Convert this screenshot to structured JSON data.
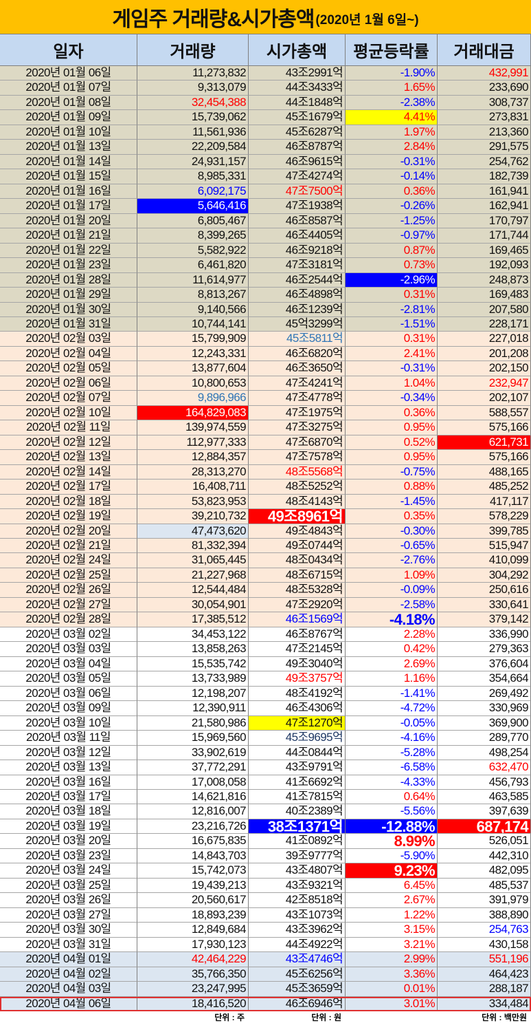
{
  "title": {
    "main": "게임주 거래량&시가총액",
    "sub": "(2020년 1월 6일~)"
  },
  "headers": [
    "일자",
    "거래량",
    "시가총액",
    "평균등락률",
    "거래대금"
  ],
  "footer": {
    "volume_unit": "단위 : 주",
    "cap_unit": "단위 : 원",
    "amount_unit": "단위 : 백만원"
  },
  "colors": {
    "title_bg": "#ffc000",
    "header_bg": "#c5d9f1",
    "jan_bg": "#ddd9c4",
    "feb_bg": "#fde9d9",
    "mar_bg": "#ffffff",
    "apr_bg": "#dce6f1",
    "up": "#ff0000",
    "down": "#0000ff"
  },
  "rows": [
    [
      "2020년 01월 06일",
      "11,273,832",
      "43조2991억",
      "-1.90%",
      "432,991",
      "jan",
      {
        "a": "red"
      }
    ],
    [
      "2020년 01월 07일",
      "9,313,079",
      "44조3433억",
      "1.65%",
      "233,690",
      "jan",
      {}
    ],
    [
      "2020년 01월 08일",
      "32,454,388",
      "44조1848억",
      "-2.38%",
      "308,737",
      "jan",
      {
        "v": "red"
      }
    ],
    [
      "2020년 01월 09일",
      "15,739,062",
      "45조1679억",
      "4.41%",
      "273,831",
      "jan",
      {
        "r": "yfill"
      }
    ],
    [
      "2020년 01월 10일",
      "11,561,936",
      "45조6287억",
      "1.97%",
      "213,360",
      "jan",
      {}
    ],
    [
      "2020년 01월 13일",
      "22,209,584",
      "46조8787억",
      "2.84%",
      "291,575",
      "jan",
      {}
    ],
    [
      "2020년 01월 14일",
      "24,931,157",
      "46조9615억",
      "-0.31%",
      "254,762",
      "jan",
      {}
    ],
    [
      "2020년 01월 15일",
      "8,985,331",
      "47조4274억",
      "-0.14%",
      "182,739",
      "jan",
      {}
    ],
    [
      "2020년 01월 16일",
      "6,092,175",
      "47조7500억",
      "0.36%",
      "161,941",
      "jan",
      {
        "v": "blue",
        "c": "red"
      }
    ],
    [
      "2020년 01월 17일",
      "5,646,416",
      "47조1938억",
      "-0.26%",
      "162,941",
      "jan",
      {
        "v": "bfill"
      }
    ],
    [
      "2020년 01월 20일",
      "6,805,467",
      "46조8587억",
      "-1.25%",
      "170,797",
      "jan",
      {}
    ],
    [
      "2020년 01월 21일",
      "8,399,265",
      "46조4405억",
      "-0.97%",
      "171,744",
      "jan",
      {}
    ],
    [
      "2020년 01월 22일",
      "5,582,922",
      "46조9218억",
      "0.87%",
      "169,465",
      "jan",
      {}
    ],
    [
      "2020년 01월 23일",
      "6,461,820",
      "47조3181억",
      "0.73%",
      "192,093",
      "jan",
      {}
    ],
    [
      "2020년 01월 28일",
      "11,614,977",
      "46조2544억",
      "-2.96%",
      "248,873",
      "jan",
      {
        "r": "bfill"
      }
    ],
    [
      "2020년 01월 29일",
      "8,813,267",
      "46조4898억",
      "0.31%",
      "169,483",
      "jan",
      {}
    ],
    [
      "2020년 01월 30일",
      "9,140,566",
      "46조1239억",
      "-2.81%",
      "207,580",
      "jan",
      {}
    ],
    [
      "2020년 01월 31일",
      "10,744,141",
      "45억3299억",
      "-1.51%",
      "228,171",
      "jan",
      {}
    ],
    [
      "2020년 02월 03일",
      "15,799,909",
      "45조5811억",
      "0.31%",
      "227,018",
      "feb",
      {
        "c": "lblue"
      }
    ],
    [
      "2020년 02월 04일",
      "12,243,331",
      "46조6820억",
      "2.41%",
      "201,208",
      "feb",
      {}
    ],
    [
      "2020년 02월 05일",
      "13,877,604",
      "46조3650억",
      "-0.31%",
      "202,150",
      "feb",
      {}
    ],
    [
      "2020년 02월 06일",
      "10,800,653",
      "47조4241억",
      "1.04%",
      "232,947",
      "feb",
      {
        "a": "red"
      }
    ],
    [
      "2020년 02월 07일",
      "9,896,966",
      "47조4778억",
      "-0.34%",
      "202,107",
      "feb",
      {
        "v": "lblue"
      }
    ],
    [
      "2020년 02월 10일",
      "164,829,083",
      "47조1975억",
      "0.36%",
      "588,557",
      "feb",
      {
        "v": "rfill"
      }
    ],
    [
      "2020년 02월 11일",
      "139,974,559",
      "47조3275억",
      "0.95%",
      "575,166",
      "feb",
      {}
    ],
    [
      "2020년 02월 12일",
      "112,977,333",
      "47조6870억",
      "0.52%",
      "621,731",
      "feb",
      {
        "a": "rfill"
      }
    ],
    [
      "2020년 02월 13일",
      "12,884,357",
      "47조7578억",
      "0.95%",
      "575,166",
      "feb",
      {}
    ],
    [
      "2020년 02월 14일",
      "28,313,270",
      "48조5568억",
      "-0.75%",
      "488,165",
      "feb",
      {
        "c": "red"
      }
    ],
    [
      "2020년 02월 17일",
      "16,408,711",
      "48조5252억",
      "0.88%",
      "485,252",
      "feb",
      {}
    ],
    [
      "2020년 02월 18일",
      "53,823,953",
      "48조4143억",
      "-1.45%",
      "417,117",
      "feb",
      {}
    ],
    [
      "2020년 02월 19일",
      "39,210,732",
      "49조8961억",
      "0.35%",
      "578,229",
      "feb",
      {
        "c": "rfill big"
      }
    ],
    [
      "2020년 02월 20일",
      "47,473,620",
      "49조4843억",
      "-0.30%",
      "399,785",
      "feb",
      {
        "v": "lbfill"
      }
    ],
    [
      "2020년 02월 21일",
      "81,332,394",
      "49조0744억",
      "-0.65%",
      "515,947",
      "feb",
      {}
    ],
    [
      "2020년 02월 24일",
      "31,065,445",
      "48조0434억",
      "-2.76%",
      "410,099",
      "feb",
      {}
    ],
    [
      "2020년 02월 25일",
      "21,227,968",
      "48조6715억",
      "1.09%",
      "304,292",
      "feb",
      {}
    ],
    [
      "2020년 02월 26일",
      "12,544,484",
      "48조5328억",
      "-0.09%",
      "250,616",
      "feb",
      {}
    ],
    [
      "2020년 02월 27일",
      "30,054,901",
      "47조2920억",
      "-2.58%",
      "330,641",
      "feb",
      {}
    ],
    [
      "2020년 02월 28일",
      "17,385,512",
      "46조1569억",
      "-4.18%",
      "379,142",
      "feb",
      {
        "c": "blue",
        "r": "blue big"
      }
    ],
    [
      "2020년 03월 02일",
      "34,453,122",
      "46조8767억",
      "2.28%",
      "336,990",
      "mar",
      {}
    ],
    [
      "2020년 03월 03일",
      "13,858,263",
      "47조2145억",
      "0.42%",
      "279,363",
      "mar",
      {}
    ],
    [
      "2020년 03월 04일",
      "15,535,742",
      "49조3040억",
      "2.69%",
      "376,604",
      "mar",
      {}
    ],
    [
      "2020년 03월 05일",
      "13,733,989",
      "49조3757억",
      "1.16%",
      "354,664",
      "mar",
      {
        "c": "red"
      }
    ],
    [
      "2020년 03월 06일",
      "12,198,207",
      "48조4192억",
      "-1.41%",
      "269,492",
      "mar",
      {}
    ],
    [
      "2020년 03월 09일",
      "12,390,911",
      "46조4306억",
      "-4.72%",
      "330,969",
      "mar",
      {}
    ],
    [
      "2020년 03월 10일",
      "21,580,986",
      "47조1270억",
      "-0.05%",
      "369,900",
      "mar",
      {
        "c": "yfillk"
      }
    ],
    [
      "2020년 03월 11일",
      "15,969,560",
      "45조9695억",
      "-4.16%",
      "289,770",
      "mar",
      {
        "c": "navy"
      }
    ],
    [
      "2020년 03월 12일",
      "33,902,619",
      "44조0844억",
      "-5.28%",
      "498,254",
      "mar",
      {}
    ],
    [
      "2020년 03월 13일",
      "37,772,291",
      "43조9791억",
      "-6.58%",
      "632,470",
      "mar",
      {
        "a": "red"
      }
    ],
    [
      "2020년 03월 16일",
      "17,008,058",
      "41조6692억",
      "-4.33%",
      "456,793",
      "mar",
      {}
    ],
    [
      "2020년 03월 17일",
      "14,621,816",
      "41조7815억",
      "0.64%",
      "463,585",
      "mar",
      {}
    ],
    [
      "2020년 03월 18일",
      "12,816,007",
      "40조2389억",
      "-5.56%",
      "397,639",
      "mar",
      {}
    ],
    [
      "2020년 03월 19일",
      "23,216,726",
      "38조1371억",
      "-12.88%",
      "687,174",
      "mar",
      {
        "c": "bfill big",
        "r": "bfill big",
        "a": "rfill big"
      }
    ],
    [
      "2020년 03월 20일",
      "16,675,835",
      "41조0892억",
      "8.99%",
      "526,051",
      "mar",
      {
        "r": "red big"
      }
    ],
    [
      "2020년 03월 23일",
      "14,843,703",
      "39조9777억",
      "-5.90%",
      "442,310",
      "mar",
      {}
    ],
    [
      "2020년 03월 24일",
      "15,742,073",
      "43조4807억",
      "9.23%",
      "482,095",
      "mar",
      {
        "r": "rfill big"
      }
    ],
    [
      "2020년 03월 25일",
      "19,439,213",
      "43조9321억",
      "6.45%",
      "485,537",
      "mar",
      {}
    ],
    [
      "2020년 03월 26일",
      "20,560,617",
      "42조8518억",
      "2.67%",
      "391,979",
      "mar",
      {}
    ],
    [
      "2020년 03월 27일",
      "18,893,239",
      "43조1073억",
      "1.22%",
      "388,890",
      "mar",
      {}
    ],
    [
      "2020년 03월 30일",
      "12,849,684",
      "43조3962억",
      "3.15%",
      "254,763",
      "mar",
      {
        "a": "blue"
      }
    ],
    [
      "2020년 03월 31일",
      "17,930,123",
      "44조4922억",
      "3.21%",
      "430,158",
      "mar",
      {}
    ],
    [
      "2020년 04월 01일",
      "42,464,229",
      "43조4746억",
      "2.99%",
      "551,196",
      "apr",
      {
        "v": "red",
        "c": "blue",
        "a": "red"
      }
    ],
    [
      "2020년 04월 02일",
      "35,766,350",
      "45조6256억",
      "3.36%",
      "464,423",
      "apr",
      {}
    ],
    [
      "2020년 04월 03일",
      "23,247,995",
      "45조3659억",
      "0.01%",
      "288,187",
      "apr",
      {}
    ],
    [
      "2020년 04월 06일",
      "18,416,520",
      "46조6946억",
      "3.01%",
      "334,484",
      "apr",
      {
        "row": "last"
      }
    ]
  ]
}
